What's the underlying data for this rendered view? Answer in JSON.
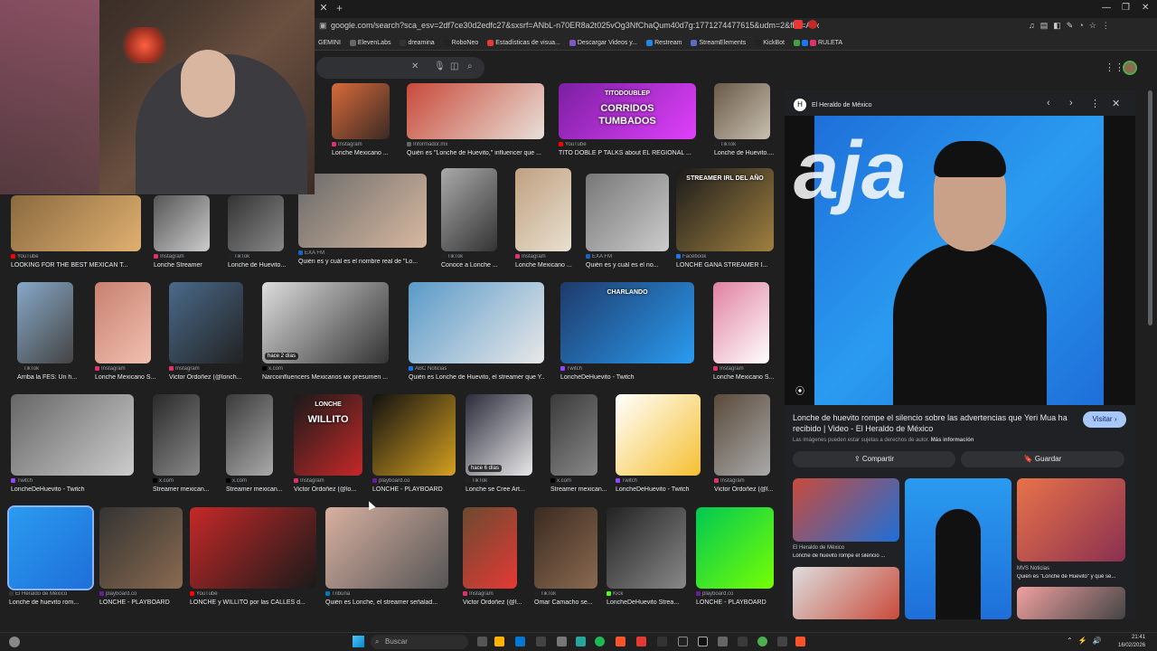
{
  "browser": {
    "url": "google.com/search?sca_esv=2df7ce30d2edfc27&sxsrf=ANbL-n70ER8a2t025vOg3NfChaQum40d7g:1771274477615&udm=2&fbs=ADc_l-bpk8W4E-q...",
    "bookmarks": [
      "GEMINI",
      "ElevenLabs",
      "dreamina",
      "RoboNeo",
      "Estadísticas de visua...",
      "Descargar Videos y...",
      "Restream",
      "StreamElements",
      "KickBot",
      "RULETA"
    ]
  },
  "results": [
    {
      "src": "Instagram",
      "title": "Lonche Mexicano ...",
      "color": "#e1306c"
    },
    {
      "src": "Informador.mx",
      "title": "Quién es \"Lonche de Huevito,\" influencer que ...",
      "color": "#666"
    },
    {
      "src": "YouTube",
      "title": "TITO DOBLE P TALKS about EL REGIONAL ...",
      "color": "#ff0000",
      "overlay1": "TITODOUBLEP",
      "overlay2": "CORRIDOS",
      "overlay3": "TUMBADOS"
    },
    {
      "src": "TikTok",
      "title": "Lonche de Huevito....",
      "color": "#222"
    },
    {
      "src": "YouTube",
      "title": "LOOKING FOR THE BEST MEXICAN T...",
      "color": "#ff0000"
    },
    {
      "src": "Instagram",
      "title": "Lonche Streamer",
      "color": "#e1306c"
    },
    {
      "src": "TikTok",
      "title": "Lonche de Huevito...",
      "color": "#222"
    },
    {
      "src": "EXA FM",
      "title": "Quién es y cuál es el nombre real de \"Lo...",
      "color": "#1565c0"
    },
    {
      "src": "TikTok",
      "title": "Conoce a Lonche ...",
      "color": "#222"
    },
    {
      "src": "Instagram",
      "title": "Lonche Mexicano ...",
      "color": "#e1306c"
    },
    {
      "src": "EXA FM",
      "title": "Quién es y cuál es el no...",
      "color": "#1565c0"
    },
    {
      "src": "Facebook",
      "title": "LONCHE GANA STREAMER I...",
      "color": "#1877f2",
      "overlay1": "STREAMER IRL DEL AÑO"
    },
    {
      "src": "TikTok",
      "title": "Arriba la FES: Un h...",
      "color": "#222"
    },
    {
      "src": "Instagram",
      "title": "Lonche Mexicano S...",
      "color": "#e1306c"
    },
    {
      "src": "Instagram",
      "title": "Victor Ordoñez (@lonch...",
      "color": "#e1306c"
    },
    {
      "src": "x.com",
      "title": "Narcoinfluencers Mexicanos мx presumen ...",
      "color": "#000",
      "badge": "hace 2 días"
    },
    {
      "src": "ABC Noticias",
      "title": "Quién es Lonche de Huevito, el streamer que Y...",
      "color": "#1a73e8"
    },
    {
      "src": "Twitch",
      "title": "LoncheDeHuevito - Twitch",
      "color": "#9146ff",
      "overlay1": "CHARLANDO"
    },
    {
      "src": "Instagram",
      "title": "Lonche Mexicano S...",
      "color": "#e1306c"
    },
    {
      "src": "Twitch",
      "title": "LoncheDeHuevito - Twitch",
      "color": "#9146ff"
    },
    {
      "src": "x.com",
      "title": "Streamer mexican...",
      "color": "#000"
    },
    {
      "src": "x.com",
      "title": "Streamer mexican...",
      "color": "#000"
    },
    {
      "src": "Instagram",
      "title": "Victor Ordoñez (@lo...",
      "color": "#e1306c",
      "overlay1": "LONCHE",
      "overlay2": "WILLITO"
    },
    {
      "src": "playboard.co",
      "title": "LONCHE - PLAYBOARD",
      "color": "#6a1b9a"
    },
    {
      "src": "TikTok",
      "title": "Lonche se Cree Art...",
      "color": "#222",
      "badge": "hace 6 días"
    },
    {
      "src": "x.com",
      "title": "Streamer mexican...",
      "color": "#000"
    },
    {
      "src": "Twitch",
      "title": "LoncheDeHuevito - Twitch",
      "color": "#9146ff"
    },
    {
      "src": "Instagram",
      "title": "Victor Ordoñez (@l...",
      "color": "#e1306c"
    },
    {
      "src": "El Heraldo de México",
      "title": "Lonche de huevito rom...",
      "color": "#333"
    },
    {
      "src": "playboard.co",
      "title": "LONCHE - PLAYBOARD",
      "color": "#6a1b9a"
    },
    {
      "src": "YouTube",
      "title": "LONCHE y WILLITO por las CALLES d...",
      "color": "#ff0000"
    },
    {
      "src": "Tribuna",
      "title": "Quién es Lonche, el streamer señalad...",
      "color": "#0277bd"
    },
    {
      "src": "Instagram",
      "title": "Victor Ordoñez (@l...",
      "color": "#e1306c"
    },
    {
      "src": "TikTok",
      "title": "Omar Camacho se...",
      "color": "#222"
    },
    {
      "src": "Kick",
      "title": "LoncheDeHuevito Strea...",
      "color": "#53fc18"
    },
    {
      "src": "playboard.co",
      "title": "LONCHE - PLAYBOARD",
      "color": "#6a1b9a"
    }
  ],
  "panel": {
    "source": "El Heraldo de México",
    "title": "Lonche de huevito rompe el silencio sobre las advertencias que Yeri Mua ha recibido | Video - El Heraldo de México",
    "visit_label": "Visitar",
    "rights_text": "Las imágenes pueden estar sujetas a derechos de autor.",
    "rights_link": "Más información",
    "share_label": "Compartir",
    "save_label": "Guardar",
    "main_overlay": "aja",
    "related": [
      {
        "src": "El Heraldo de México",
        "title": "Lonche de huevito rompe el silencio ..."
      },
      {
        "src": "MVS Noticias",
        "title": "Quién es \"Lonche de Huevito\" y qué se..."
      }
    ]
  },
  "taskbar": {
    "search_placeholder": "Buscar",
    "time": "21:41",
    "date": "16/02/2026"
  }
}
